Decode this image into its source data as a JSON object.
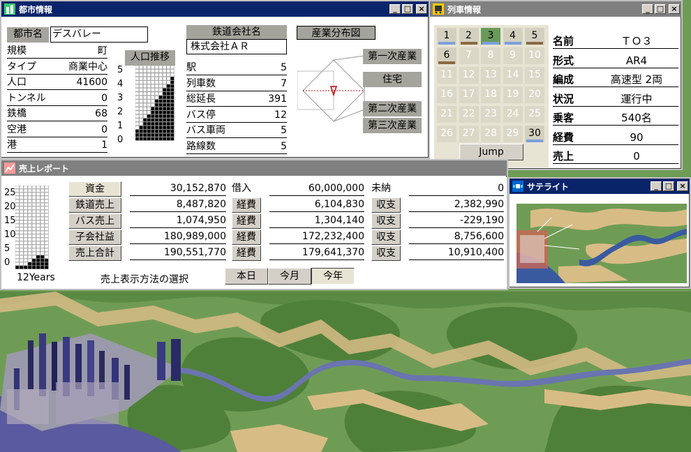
{
  "city": {
    "title": "都市情報",
    "name_label": "都市名",
    "name_value": "デスバレー",
    "rows": [
      {
        "k": "規模",
        "v": "町"
      },
      {
        "k": "タイプ",
        "v": "商業中心"
      },
      {
        "k": "人口",
        "v": "41600"
      },
      {
        "k": "トンネル",
        "v": "0"
      },
      {
        "k": "鉄橋",
        "v": "68"
      },
      {
        "k": "空港",
        "v": "0"
      },
      {
        "k": "港",
        "v": "1"
      }
    ],
    "pop_button": "人口推移",
    "pop_axis": [
      "5",
      "4",
      "3",
      "2",
      "1",
      "0"
    ],
    "company_label": "鉄道会社名",
    "company_value": "株式会社ＡＲ",
    "rail_rows": [
      {
        "k": "駅",
        "v": "5"
      },
      {
        "k": "列車数",
        "v": "7"
      },
      {
        "k": "総延長",
        "v": "391"
      },
      {
        "k": "バス停",
        "v": "12"
      },
      {
        "k": "バス車両",
        "v": "5"
      },
      {
        "k": "路線数",
        "v": "5"
      }
    ],
    "industry_button": "産業分布図",
    "industry": [
      "第一次産業",
      "住宅",
      "第二次産業",
      "第三次産業"
    ]
  },
  "train": {
    "title": "列車情報",
    "cells": [
      "1",
      "2",
      "3",
      "4",
      "5",
      "6",
      "7",
      "8",
      "9",
      "10",
      "11",
      "12",
      "13",
      "14",
      "15",
      "16",
      "17",
      "18",
      "19",
      "20",
      "21",
      "22",
      "23",
      "24",
      "25",
      "26",
      "27",
      "28",
      "29",
      "30"
    ],
    "jump": "Jump",
    "info": [
      {
        "k": "名前",
        "v": "ＴＯ３"
      },
      {
        "k": "形式",
        "v": "AR4"
      },
      {
        "k": "編成",
        "v": "高速型 2両"
      },
      {
        "k": "状況",
        "v": "運行中"
      },
      {
        "k": "乗客",
        "v": "540名"
      },
      {
        "k": "経費",
        "v": "90"
      },
      {
        "k": "売上",
        "v": "0"
      }
    ]
  },
  "sales": {
    "title": "売上レポート",
    "axis": [
      "25",
      "20",
      "15",
      "10",
      "5",
      "0"
    ],
    "years": "12Years",
    "rows": [
      {
        "label": "資金",
        "v1": "30,152,870",
        "m": "借入",
        "v2": "60,000,000",
        "r": "未納",
        "v3": "0"
      },
      {
        "label": "鉄道売上",
        "v1": "8,487,820",
        "m": "経費",
        "v2": "6,104,830",
        "r": "収支",
        "v3": "2,382,990"
      },
      {
        "label": "バス売上",
        "v1": "1,074,950",
        "m": "経費",
        "v2": "1,304,140",
        "r": "収支",
        "v3": "-229,190"
      },
      {
        "label": "子会社益",
        "v1": "180,989,000",
        "m": "経費",
        "v2": "172,232,400",
        "r": "収支",
        "v3": "8,756,600"
      },
      {
        "label": "売上合計",
        "v1": "190,551,770",
        "m": "経費",
        "v2": "179,641,370",
        "r": "収支",
        "v3": "10,910,400"
      }
    ],
    "method_label": "売上表示方法の選択",
    "periods": [
      "本日",
      "今月",
      "今年"
    ]
  },
  "satellite": {
    "title": "サテライト"
  },
  "colors": {
    "title_active": "#0a246a",
    "title_inactive": "#808080",
    "map_green": "#6f9c55",
    "river": "#6a74b0"
  }
}
